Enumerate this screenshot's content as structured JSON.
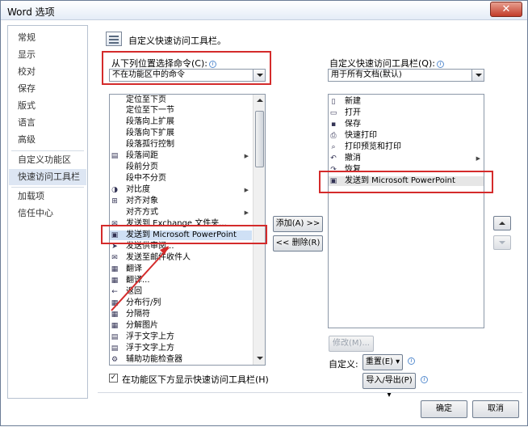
{
  "window": {
    "title": "Word 选项",
    "close_label": "✕"
  },
  "nav": {
    "items": [
      {
        "label": "常规"
      },
      {
        "label": "显示"
      },
      {
        "label": "校对"
      },
      {
        "label": "保存"
      },
      {
        "label": "版式"
      },
      {
        "label": "语言"
      },
      {
        "label": "高级"
      },
      {
        "label": "自定义功能区"
      },
      {
        "label": "快速访问工具栏"
      },
      {
        "label": "加载项"
      },
      {
        "label": "信任中心"
      }
    ],
    "selected_index": 8
  },
  "header": {
    "title": "自定义快速访问工具栏。"
  },
  "left": {
    "choose_label": "从下列位置选择命令(C):",
    "choose_value": "不在功能区中的命令",
    "commands": [
      {
        "icon": "",
        "label": "定位至下页"
      },
      {
        "icon": "",
        "label": "定位至下一节"
      },
      {
        "icon": "",
        "label": "段落向上扩展"
      },
      {
        "icon": "",
        "label": "段落向下扩展"
      },
      {
        "icon": "",
        "label": "段落孤行控制"
      },
      {
        "icon": "▤",
        "label": "段落间距",
        "sub": true
      },
      {
        "icon": "",
        "label": "段前分页"
      },
      {
        "icon": "",
        "label": "段中不分页"
      },
      {
        "icon": "◑",
        "label": "对比度",
        "sub": true
      },
      {
        "icon": "⊞",
        "label": "对齐对象"
      },
      {
        "icon": "",
        "label": "对齐方式",
        "sub": true
      },
      {
        "icon": "✉",
        "label": "发送到 Exchange 文件夹..."
      },
      {
        "icon": "▣",
        "label": "发送到 Microsoft PowerPoint"
      },
      {
        "icon": "➤",
        "label": "发送供审阅..."
      },
      {
        "icon": "✉",
        "label": "发送至邮件收件人"
      },
      {
        "icon": "▦",
        "label": "翻译"
      },
      {
        "icon": "▦",
        "label": "翻译..."
      },
      {
        "icon": "←",
        "label": "返回"
      },
      {
        "icon": "▦",
        "label": "分布行/列"
      },
      {
        "icon": "▦",
        "label": "分隔符"
      },
      {
        "icon": "▦",
        "label": "分解图片"
      },
      {
        "icon": "▤",
        "label": "浮于文字上方"
      },
      {
        "icon": "▤",
        "label": "浮于文字上方"
      },
      {
        "icon": "⚙",
        "label": "辅助功能检查器"
      }
    ],
    "selected_index": 12
  },
  "right": {
    "customize_label": "自定义快速访问工具栏(Q):",
    "customize_value": "用于所有文档(默认)",
    "items": [
      {
        "icon": "▯",
        "label": "新建"
      },
      {
        "icon": "▭",
        "label": "打开"
      },
      {
        "icon": "▪",
        "label": "保存"
      },
      {
        "icon": "⎙",
        "label": "快速打印"
      },
      {
        "icon": "⌕",
        "label": "打印预览和打印"
      },
      {
        "icon": "↶",
        "label": "撤消",
        "sub": true
      },
      {
        "icon": "↷",
        "label": "恢复"
      },
      {
        "icon": "▣",
        "label": "发送到 Microsoft PowerPoint"
      }
    ],
    "selected_index": 7,
    "modify_label": "修改(M)...",
    "custom_label": "自定义:",
    "reset_label": "重置(E) ▾",
    "import_export_label": "导入/导出(P) ▾"
  },
  "middle": {
    "add_label": "添加(A) >>",
    "remove_label": "<< 删除(R)"
  },
  "checkbox": {
    "label": "在功能区下方显示快速访问工具栏(H)",
    "checked": "✓"
  },
  "footer": {
    "ok_label": "确定",
    "cancel_label": "取消"
  },
  "colors": {
    "highlight": "#d42b2b",
    "selection": "#cfe0f5",
    "nav_selected": "#dde6f3"
  }
}
